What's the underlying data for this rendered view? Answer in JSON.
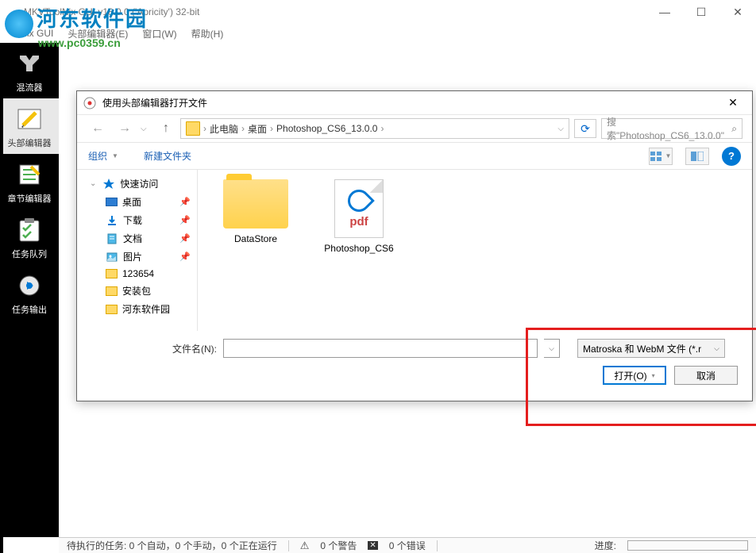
{
  "window": {
    "title": "MKVToolNix GUI v18.0.0 ('Apricity') 32-bit",
    "minimize": "—",
    "maximize": "☐",
    "close": "✕"
  },
  "watermark": {
    "main": "河东软件园",
    "sub": "www.pc0359.cn"
  },
  "menu": {
    "gui": "olNix GUI",
    "header_editor": "头部编辑器(E)",
    "window": "窗口(W)",
    "help": "帮助(H)"
  },
  "sidebar": {
    "items": [
      {
        "label": "混流器",
        "key": "mixer"
      },
      {
        "label": "头部编辑器",
        "key": "header-editor"
      },
      {
        "label": "章节编辑器",
        "key": "chapter-editor"
      },
      {
        "label": "任务队列",
        "key": "task-queue"
      },
      {
        "label": "任务输出",
        "key": "task-output"
      }
    ]
  },
  "dialog": {
    "title": "使用头部编辑器打开文件",
    "close": "✕",
    "breadcrumb": {
      "root": "›",
      "items": [
        "此电脑",
        "桌面",
        "Photoshop_CS6_13.0.0"
      ]
    },
    "nav": {
      "back": "←",
      "forward": "→",
      "up": "↑",
      "refresh": "⟳"
    },
    "search": {
      "placeholder": "搜索\"Photoshop_CS6_13.0.0\"",
      "icon": "🔍"
    },
    "toolbar": {
      "organize": "组织",
      "new_folder": "新建文件夹",
      "help": "?"
    },
    "tree": {
      "items": [
        {
          "label": "快速访问",
          "icon": "star"
        },
        {
          "label": "桌面",
          "icon": "desktop",
          "pin": true
        },
        {
          "label": "下载",
          "icon": "download",
          "pin": true
        },
        {
          "label": "文档",
          "icon": "document",
          "pin": true
        },
        {
          "label": "图片",
          "icon": "picture",
          "pin": true
        },
        {
          "label": "123654",
          "icon": "folder"
        },
        {
          "label": "安装包",
          "icon": "folder"
        },
        {
          "label": "河东软件园",
          "icon": "folder"
        }
      ]
    },
    "files": [
      {
        "name": "DataStore",
        "type": "folder"
      },
      {
        "name": "Photoshop_CS6",
        "type": "pdf"
      }
    ],
    "filename_label": "文件名(N):",
    "filename_value": "",
    "filetype": "Matroska 和 WebM 文件 (*.r",
    "open_btn": "打开(O)",
    "cancel_btn": "取消"
  },
  "statusbar": {
    "tasks": "待执行的任务: 0 个自动，0 个手动，0 个正在运行",
    "warnings": "0 个警告",
    "errors": "0 个错误",
    "progress_label": "进度:"
  }
}
